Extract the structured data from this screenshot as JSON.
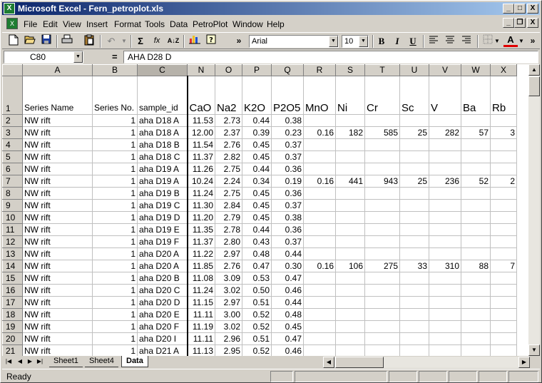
{
  "window": {
    "title": "Microsoft Excel - Fern_petroplot.xls",
    "app_icon": "excel-icon",
    "controls": {
      "minimize": "_",
      "maximize": "□",
      "close": "X"
    }
  },
  "menu": [
    "File",
    "Edit",
    "View",
    "Insert",
    "Format",
    "Tools",
    "Data",
    "PetroPlot",
    "Window",
    "Help"
  ],
  "toolbar": {
    "icons": [
      "new-icon",
      "open-icon",
      "save-icon",
      "print-icon",
      "paste-icon",
      "undo-icon",
      "autosum-icon",
      "function-icon",
      "sort-ascending-icon",
      "chart-wizard-icon",
      "help-icon"
    ],
    "autosum_glyph": "Σ",
    "function_glyph": "fx",
    "sort_glyph": "A↓Z",
    "overflow_glyph": "»",
    "font": "Arial",
    "font_size": "10",
    "bold": "B",
    "italic": "I",
    "underline": "U",
    "font_color_glyph": "A"
  },
  "formula_bar": {
    "name_box": "C80",
    "equals": "=",
    "formula": "AHA D28 D"
  },
  "columns": [
    "A",
    "B",
    "C",
    "N",
    "O",
    "P",
    "Q",
    "R",
    "S",
    "T",
    "U",
    "V",
    "W",
    "X"
  ],
  "header_row": {
    "row_no": "1",
    "cells": [
      "Series Name",
      "Series No.",
      "sample_id",
      "CaO",
      "Na2",
      "K2O",
      "P2O5",
      "MnO",
      "Ni",
      "Cr",
      "Sc",
      "V",
      "Ba",
      "Rb"
    ]
  },
  "rows": [
    {
      "n": "2",
      "c": [
        "NW rift",
        "1",
        "aha D18 A",
        "11.53",
        "2.73",
        "0.44",
        "0.38",
        "",
        "",
        "",
        "",
        "",
        "",
        ""
      ]
    },
    {
      "n": "3",
      "c": [
        "NW rift",
        "1",
        "aha D18 A",
        "12.00",
        "2.37",
        "0.39",
        "0.23",
        "0.16",
        "182",
        "585",
        "25",
        "282",
        "57",
        "3"
      ]
    },
    {
      "n": "4",
      "c": [
        "NW rift",
        "1",
        "aha D18 B",
        "11.54",
        "2.76",
        "0.45",
        "0.37",
        "",
        "",
        "",
        "",
        "",
        "",
        ""
      ]
    },
    {
      "n": "5",
      "c": [
        "NW rift",
        "1",
        "aha D18 C",
        "11.37",
        "2.82",
        "0.45",
        "0.37",
        "",
        "",
        "",
        "",
        "",
        "",
        ""
      ]
    },
    {
      "n": "6",
      "c": [
        "NW rift",
        "1",
        "aha D19 A",
        "11.26",
        "2.75",
        "0.44",
        "0.36",
        "",
        "",
        "",
        "",
        "",
        "",
        ""
      ]
    },
    {
      "n": "7",
      "c": [
        "NW rift",
        "1",
        "aha D19 A",
        "10.24",
        "2.24",
        "0.34",
        "0.19",
        "0.16",
        "441",
        "943",
        "25",
        "236",
        "52",
        "2"
      ]
    },
    {
      "n": "8",
      "c": [
        "NW rift",
        "1",
        "aha D19 B",
        "11.24",
        "2.75",
        "0.45",
        "0.36",
        "",
        "",
        "",
        "",
        "",
        "",
        ""
      ]
    },
    {
      "n": "9",
      "c": [
        "NW rift",
        "1",
        "aha D19 C",
        "11.30",
        "2.84",
        "0.45",
        "0.37",
        "",
        "",
        "",
        "",
        "",
        "",
        ""
      ]
    },
    {
      "n": "10",
      "c": [
        "NW rift",
        "1",
        "aha D19 D",
        "11.20",
        "2.79",
        "0.45",
        "0.38",
        "",
        "",
        "",
        "",
        "",
        "",
        ""
      ]
    },
    {
      "n": "11",
      "c": [
        "NW rift",
        "1",
        "aha D19 E",
        "11.35",
        "2.78",
        "0.44",
        "0.36",
        "",
        "",
        "",
        "",
        "",
        "",
        ""
      ]
    },
    {
      "n": "12",
      "c": [
        "NW rift",
        "1",
        "aha D19 F",
        "11.37",
        "2.80",
        "0.43",
        "0.37",
        "",
        "",
        "",
        "",
        "",
        "",
        ""
      ]
    },
    {
      "n": "13",
      "c": [
        "NW rift",
        "1",
        "aha D20 A",
        "11.22",
        "2.97",
        "0.48",
        "0.44",
        "",
        "",
        "",
        "",
        "",
        "",
        ""
      ]
    },
    {
      "n": "14",
      "c": [
        "NW rift",
        "1",
        "aha D20 A",
        "11.85",
        "2.76",
        "0.47",
        "0.30",
        "0.16",
        "106",
        "275",
        "33",
        "310",
        "88",
        "7"
      ]
    },
    {
      "n": "15",
      "c": [
        "NW rift",
        "1",
        "aha D20 B",
        "11.08",
        "3.09",
        "0.53",
        "0.47",
        "",
        "",
        "",
        "",
        "",
        "",
        ""
      ]
    },
    {
      "n": "16",
      "c": [
        "NW rift",
        "1",
        "aha D20 C",
        "11.24",
        "3.02",
        "0.50",
        "0.46",
        "",
        "",
        "",
        "",
        "",
        "",
        ""
      ]
    },
    {
      "n": "17",
      "c": [
        "NW rift",
        "1",
        "aha D20 D",
        "11.15",
        "2.97",
        "0.51",
        "0.44",
        "",
        "",
        "",
        "",
        "",
        "",
        ""
      ]
    },
    {
      "n": "18",
      "c": [
        "NW rift",
        "1",
        "aha D20 E",
        "11.11",
        "3.00",
        "0.52",
        "0.48",
        "",
        "",
        "",
        "",
        "",
        "",
        ""
      ]
    },
    {
      "n": "19",
      "c": [
        "NW rift",
        "1",
        "aha D20 F",
        "11.19",
        "3.02",
        "0.52",
        "0.45",
        "",
        "",
        "",
        "",
        "",
        "",
        ""
      ]
    },
    {
      "n": "20",
      "c": [
        "NW rift",
        "1",
        "aha D20 I",
        "11.11",
        "2.96",
        "0.51",
        "0.47",
        "",
        "",
        "",
        "",
        "",
        "",
        ""
      ]
    },
    {
      "n": "21",
      "c": [
        "NW rift",
        "1",
        "aha D21 A",
        "11.13",
        "2.95",
        "0.52",
        "0.46",
        "",
        "",
        "",
        "",
        "",
        "",
        ""
      ]
    }
  ],
  "sheet_tabs": [
    "Sheet1",
    "Sheet4",
    "Data"
  ],
  "active_tab": "Data",
  "status": "Ready"
}
